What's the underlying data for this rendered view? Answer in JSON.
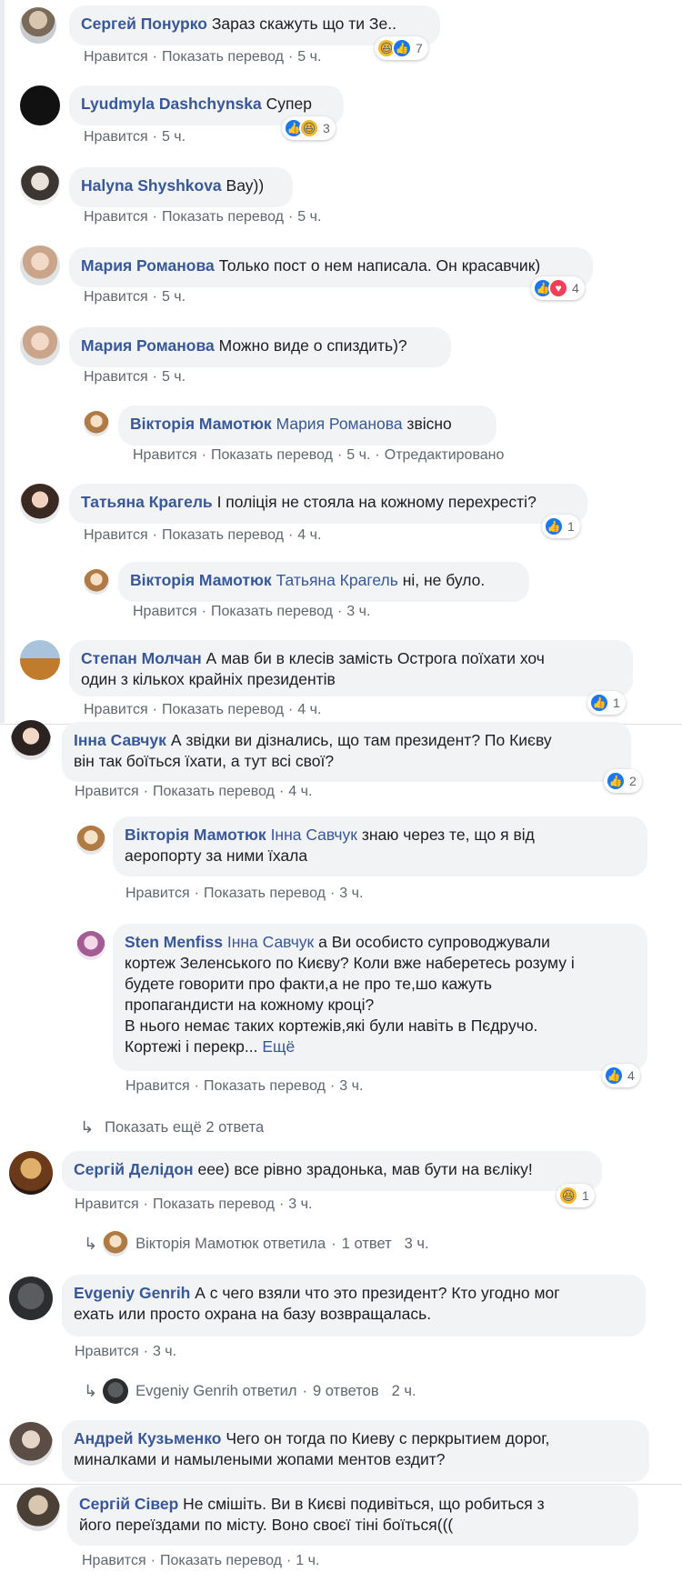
{
  "ui": {
    "like": "Нравится",
    "translate": "Показать перевод",
    "edited": "Отредактировано",
    "more": "Ещё"
  },
  "comments": [
    {
      "name": "Сергей Понурко",
      "text": "Зараз скажуть що ти Зе..",
      "time": "5 ч.",
      "reactions": [
        "haha",
        "like"
      ],
      "count": "7"
    },
    {
      "name": "Lyudmyla Dashchynska",
      "text": "Супер",
      "time": "5 ч.",
      "reactions": [
        "like",
        "haha"
      ],
      "count": "3"
    },
    {
      "name": "Halyna Shyshkova",
      "text": "Вау))",
      "time": "5 ч."
    },
    {
      "name": "Мария Романова",
      "text": "Только пост о нем написала. Он красавчик)",
      "time": "5 ч.",
      "reactions": [
        "like",
        "love"
      ],
      "count": "4"
    },
    {
      "name": "Мария Романова",
      "text": "Можно виде о спиздить)?",
      "time": "5 ч."
    },
    {
      "name": "Вікторія Мамотюк",
      "mention": "Мария Романова",
      "text": "звісно",
      "time": "5 ч."
    },
    {
      "name": "Татьяна Крагель",
      "text": "І поліція не стояла на кожному перехресті?",
      "time": "4 ч.",
      "reactions": [
        "like"
      ],
      "count": "1"
    },
    {
      "name": "Вікторія Мамотюк",
      "mention": "Татьяна Крагель",
      "text": "ні, не було.",
      "time": "3 ч."
    },
    {
      "name": "Степан Молчан",
      "text1": "А мав би в клесів замість Острога поїхати хоч",
      "text2": "один з кількох крайніх президентів",
      "time": "4 ч.",
      "reactions": [
        "like"
      ],
      "count": "1"
    },
    {
      "name": "Інна Савчук",
      "text1": "А звідки ви дізнались, що там президент? По Києву",
      "text2": "він так боїться їхати, а тут всі свої?",
      "time": "4 ч.",
      "reactions": [
        "like"
      ],
      "count": "2"
    },
    {
      "name": "Вікторія Мамотюк",
      "mention": "Інна Савчук",
      "text1": "знаю через те, що я від",
      "text2": "аеропорту за ними їхала",
      "time": "3 ч."
    },
    {
      "name": "Sten Menfiss",
      "mention": "Інна Савчук",
      "text1": "а Ви особисто супроводжували",
      "text2": "кортеж Зеленського по Києву? Коли вже наберетесь розуму і",
      "text3": "будете говорити про факти,а не про те,шо кажуть",
      "text4": "пропагандисти на кожному кроці?",
      "text5": "В нього немає таких кортежів,які були навіть в Пєдручо.",
      "text6": "Кортежі і перекр...",
      "time": "3 ч.",
      "reactions": [
        "like"
      ],
      "count": "4"
    },
    {
      "show_more": "Показать ещё 2 ответа"
    },
    {
      "name": "Сергій Делідон",
      "text": "eee) все рівно зрадонька, мав бути на вєліку!",
      "time": "3 ч.",
      "reactions": [
        "haha"
      ],
      "count": "1"
    },
    {
      "replied_name": "Вікторія Мамотюк ответила",
      "replied_count": "1 ответ",
      "replied_time": "3 ч."
    },
    {
      "name": "Evgeniy Genrih",
      "text1": "А с чего взяли что это президент? Кто угодно мог",
      "text2": "ехать или просто охрана на базу возвращалась.",
      "time": "3 ч."
    },
    {
      "replied_name": "Evgeniy Genrih ответил",
      "replied_count": "9 ответов",
      "replied_time": "2 ч."
    },
    {
      "name": "Андрей Кузьменко",
      "text1": "Чего он тогда по Киеву с перкрытием дорог,",
      "text2": "миналками и намылеными жопами ментов ездит?"
    },
    {
      "name": "Сергій Сівер",
      "text1": "Не смішіть. Ви в Києві подивіться, що робиться з",
      "text2": "його переїздами по місту. Воно своєї тіні боїться(((",
      "time": "1 ч."
    }
  ],
  "colors": {
    "link": "#385898",
    "bubble": "#f2f3f5",
    "meta": "#606770",
    "like": "#1877f2",
    "haha": "#f7b928",
    "love": "#f33e58"
  }
}
